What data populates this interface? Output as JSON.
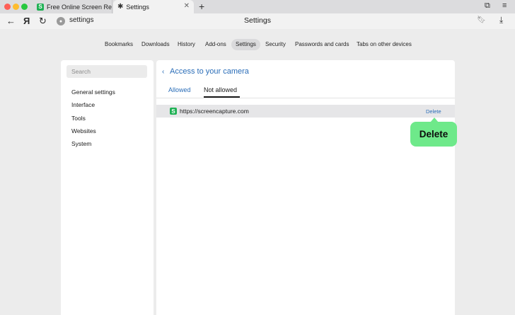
{
  "browser": {
    "tabs": [
      {
        "title": "Free Online Screen Reco",
        "icon": "screencapture-favicon"
      },
      {
        "title": "Settings",
        "icon": "gear-icon"
      }
    ],
    "address": {
      "url": "settings",
      "page_title": "Settings"
    }
  },
  "settings_nav": {
    "items": [
      "Bookmarks",
      "Downloads",
      "History",
      "Add-ons",
      "Settings",
      "Security",
      "Passwords and cards",
      "Tabs on other devices"
    ],
    "active": "Settings"
  },
  "sidebar": {
    "search_placeholder": "Search",
    "items": [
      "General settings",
      "Interface",
      "Tools",
      "Websites",
      "System"
    ]
  },
  "main": {
    "heading": "Access to your camera",
    "tabs": {
      "allowed": "Allowed",
      "not_allowed": "Not allowed"
    },
    "sites": [
      {
        "favicon_letter": "S",
        "url": "https://screencapture.com",
        "action": "Delete"
      }
    ]
  },
  "callout": {
    "label": "Delete"
  },
  "colors": {
    "accent": "#2a6db8",
    "callout": "#6ee98a",
    "favicon": "#1fb154"
  }
}
